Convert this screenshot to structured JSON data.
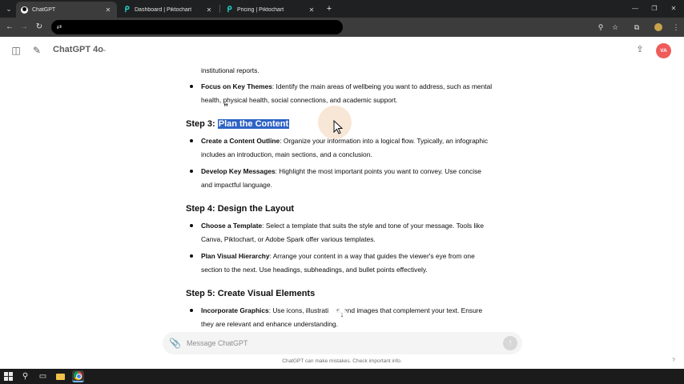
{
  "browser": {
    "tabs": [
      {
        "title": "ChatGPT",
        "favicon": "chatgpt-icon",
        "active": true
      },
      {
        "title": "Dashboard | Piktochart",
        "favicon": "piktochart-icon",
        "active": false
      },
      {
        "title": "Pricing | Piktochart",
        "favicon": "piktochart-icon",
        "active": false
      }
    ],
    "tab_close_glyph": "✕",
    "new_tab_glyph": "+",
    "window_controls": {
      "minimize": "—",
      "restore": "❐",
      "close": "✕"
    },
    "nav": {
      "back": "←",
      "forward": "→",
      "reload": "↻",
      "tune": "⇄"
    },
    "toolbar_icons": {
      "zoom": "⚲",
      "bookmark": "☆",
      "extensions": "⧉"
    }
  },
  "app": {
    "model_name": "ChatGPT 4o",
    "model_chevron": "⌄",
    "avatar_initials": "VA",
    "share_glyph": "⇪",
    "sidebar_glyph": "◫",
    "new_chat_glyph": "✎"
  },
  "conversation": {
    "top_continuation": "institutional reports.",
    "focus_bullet": {
      "bold": "Focus on Key Themes",
      "line1": ": Identify the main areas of wellbeing you want to address, such as mental",
      "line2": "health, physical health, social connections, and academic support."
    },
    "step3": {
      "prefix": "Step 3: ",
      "highlighted": "Plan the Content"
    },
    "step3_bullets": [
      {
        "bold": "Create a Content Outline",
        "line1": ": Organize your information into a logical flow. Typically, an infographic",
        "line2": "includes an introduction, main sections, and a conclusion."
      },
      {
        "bold": "Develop Key Messages",
        "line1": ": Highlight the most important points you want to convey. Use concise",
        "line2": "and impactful language."
      }
    ],
    "step4": {
      "title": "Step 4: Design the Layout"
    },
    "step4_bullets": [
      {
        "bold": "Choose a Template",
        "line1": ": Select a template that suits the style and tone of your message. Tools like",
        "line2": "Canva, Piktochart, or Adobe Spark offer various templates."
      },
      {
        "bold": "Plan Visual Hierarchy",
        "line1": ": Arrange your content in a way that guides the viewer's eye from one",
        "line2": "section to the next. Use headings, subheadings, and bullet points effectively."
      }
    ],
    "step5": {
      "title": "Step 5: Create Visual Elements"
    },
    "step5_bullets": [
      {
        "bold": "Incorporate Graphics",
        "line1": ": Use icons, illustrati",
        "line1b": "s, and images that complement your text. Ensure",
        "line2": "they are relevant and enhance understanding."
      }
    ],
    "quote_glyph": "”",
    "scroll_down_glyph": "↓"
  },
  "composer": {
    "placeholder": "Message ChatGPT",
    "attach_glyph": "📎",
    "send_glyph": "↑",
    "disclaimer": "ChatGPT can make mistakes. Check important info.",
    "help_glyph": "?"
  },
  "taskbar": {
    "search_glyph": "⚲",
    "view_glyph": "▭"
  },
  "colors": {
    "selection": "#2f63c5",
    "avatar": "#ef5b5b",
    "tab_strip": "#1f2021",
    "toolbar": "#3c3c3c",
    "piktochart": "#1ec9c0"
  }
}
